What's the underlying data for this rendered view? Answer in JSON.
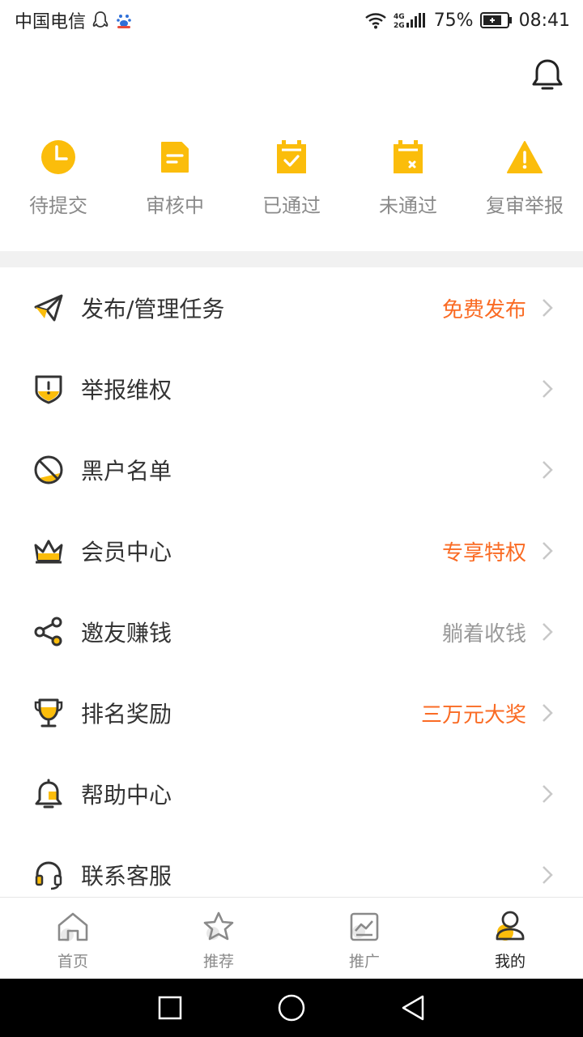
{
  "status_bar": {
    "carrier": "中国电信",
    "network": "4G 2G",
    "battery": "75%",
    "time": "08:41"
  },
  "quick_status": [
    {
      "label": "待提交",
      "icon": "clock-icon"
    },
    {
      "label": "审核中",
      "icon": "document-icon"
    },
    {
      "label": "已通过",
      "icon": "approved-icon"
    },
    {
      "label": "未通过",
      "icon": "rejected-icon"
    },
    {
      "label": "复审举报",
      "icon": "warning-icon"
    }
  ],
  "menu": [
    {
      "label": "发布/管理任务",
      "extra": "免费发布",
      "extra_style": "orange",
      "icon": "paper-plane-icon"
    },
    {
      "label": "举报维权",
      "extra": "",
      "extra_style": "gray",
      "icon": "shield-icon"
    },
    {
      "label": "黑户名单",
      "extra": "",
      "extra_style": "gray",
      "icon": "ban-icon"
    },
    {
      "label": "会员中心",
      "extra": "专享特权",
      "extra_style": "orange",
      "icon": "crown-icon"
    },
    {
      "label": "邀友赚钱",
      "extra": "躺着收钱",
      "extra_style": "gray",
      "icon": "share-icon"
    },
    {
      "label": "排名奖励",
      "extra": "三万元大奖",
      "extra_style": "orange",
      "icon": "trophy-icon"
    },
    {
      "label": "帮助中心",
      "extra": "",
      "extra_style": "gray",
      "icon": "help-bell-icon"
    },
    {
      "label": "联系客服",
      "extra": "",
      "extra_style": "gray",
      "icon": "headset-icon"
    }
  ],
  "tabs": [
    {
      "label": "首页",
      "icon": "home-icon",
      "active": false
    },
    {
      "label": "推荐",
      "icon": "star-icon",
      "active": false
    },
    {
      "label": "推广",
      "icon": "chart-icon",
      "active": false
    },
    {
      "label": "我的",
      "icon": "profile-icon",
      "active": true
    }
  ],
  "colors": {
    "accent": "#fbbd0b",
    "orange_text": "#fa6b24",
    "gray_text": "#9a9a9a"
  }
}
